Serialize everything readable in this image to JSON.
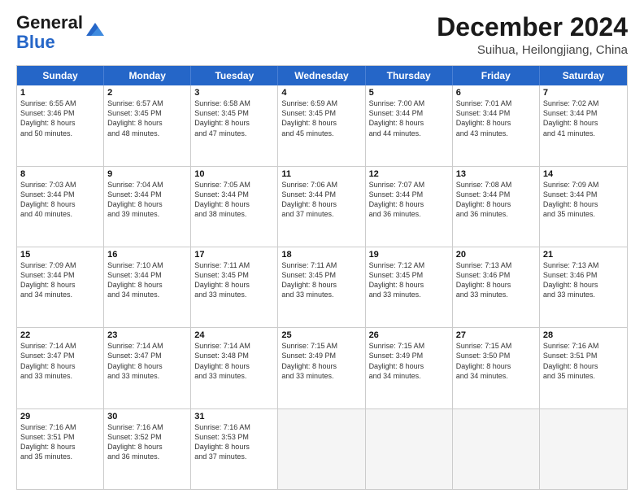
{
  "header": {
    "logo_general": "General",
    "logo_blue": "Blue",
    "month_title": "December 2024",
    "subtitle": "Suihua, Heilongjiang, China"
  },
  "calendar": {
    "days_of_week": [
      "Sunday",
      "Monday",
      "Tuesday",
      "Wednesday",
      "Thursday",
      "Friday",
      "Saturday"
    ],
    "rows": [
      [
        {
          "day": "1",
          "info": "Sunrise: 6:55 AM\nSunset: 3:46 PM\nDaylight: 8 hours\nand 50 minutes."
        },
        {
          "day": "2",
          "info": "Sunrise: 6:57 AM\nSunset: 3:45 PM\nDaylight: 8 hours\nand 48 minutes."
        },
        {
          "day": "3",
          "info": "Sunrise: 6:58 AM\nSunset: 3:45 PM\nDaylight: 8 hours\nand 47 minutes."
        },
        {
          "day": "4",
          "info": "Sunrise: 6:59 AM\nSunset: 3:45 PM\nDaylight: 8 hours\nand 45 minutes."
        },
        {
          "day": "5",
          "info": "Sunrise: 7:00 AM\nSunset: 3:44 PM\nDaylight: 8 hours\nand 44 minutes."
        },
        {
          "day": "6",
          "info": "Sunrise: 7:01 AM\nSunset: 3:44 PM\nDaylight: 8 hours\nand 43 minutes."
        },
        {
          "day": "7",
          "info": "Sunrise: 7:02 AM\nSunset: 3:44 PM\nDaylight: 8 hours\nand 41 minutes."
        }
      ],
      [
        {
          "day": "8",
          "info": "Sunrise: 7:03 AM\nSunset: 3:44 PM\nDaylight: 8 hours\nand 40 minutes."
        },
        {
          "day": "9",
          "info": "Sunrise: 7:04 AM\nSunset: 3:44 PM\nDaylight: 8 hours\nand 39 minutes."
        },
        {
          "day": "10",
          "info": "Sunrise: 7:05 AM\nSunset: 3:44 PM\nDaylight: 8 hours\nand 38 minutes."
        },
        {
          "day": "11",
          "info": "Sunrise: 7:06 AM\nSunset: 3:44 PM\nDaylight: 8 hours\nand 37 minutes."
        },
        {
          "day": "12",
          "info": "Sunrise: 7:07 AM\nSunset: 3:44 PM\nDaylight: 8 hours\nand 36 minutes."
        },
        {
          "day": "13",
          "info": "Sunrise: 7:08 AM\nSunset: 3:44 PM\nDaylight: 8 hours\nand 36 minutes."
        },
        {
          "day": "14",
          "info": "Sunrise: 7:09 AM\nSunset: 3:44 PM\nDaylight: 8 hours\nand 35 minutes."
        }
      ],
      [
        {
          "day": "15",
          "info": "Sunrise: 7:09 AM\nSunset: 3:44 PM\nDaylight: 8 hours\nand 34 minutes."
        },
        {
          "day": "16",
          "info": "Sunrise: 7:10 AM\nSunset: 3:44 PM\nDaylight: 8 hours\nand 34 minutes."
        },
        {
          "day": "17",
          "info": "Sunrise: 7:11 AM\nSunset: 3:45 PM\nDaylight: 8 hours\nand 33 minutes."
        },
        {
          "day": "18",
          "info": "Sunrise: 7:11 AM\nSunset: 3:45 PM\nDaylight: 8 hours\nand 33 minutes."
        },
        {
          "day": "19",
          "info": "Sunrise: 7:12 AM\nSunset: 3:45 PM\nDaylight: 8 hours\nand 33 minutes."
        },
        {
          "day": "20",
          "info": "Sunrise: 7:13 AM\nSunset: 3:46 PM\nDaylight: 8 hours\nand 33 minutes."
        },
        {
          "day": "21",
          "info": "Sunrise: 7:13 AM\nSunset: 3:46 PM\nDaylight: 8 hours\nand 33 minutes."
        }
      ],
      [
        {
          "day": "22",
          "info": "Sunrise: 7:14 AM\nSunset: 3:47 PM\nDaylight: 8 hours\nand 33 minutes."
        },
        {
          "day": "23",
          "info": "Sunrise: 7:14 AM\nSunset: 3:47 PM\nDaylight: 8 hours\nand 33 minutes."
        },
        {
          "day": "24",
          "info": "Sunrise: 7:14 AM\nSunset: 3:48 PM\nDaylight: 8 hours\nand 33 minutes."
        },
        {
          "day": "25",
          "info": "Sunrise: 7:15 AM\nSunset: 3:49 PM\nDaylight: 8 hours\nand 33 minutes."
        },
        {
          "day": "26",
          "info": "Sunrise: 7:15 AM\nSunset: 3:49 PM\nDaylight: 8 hours\nand 34 minutes."
        },
        {
          "day": "27",
          "info": "Sunrise: 7:15 AM\nSunset: 3:50 PM\nDaylight: 8 hours\nand 34 minutes."
        },
        {
          "day": "28",
          "info": "Sunrise: 7:16 AM\nSunset: 3:51 PM\nDaylight: 8 hours\nand 35 minutes."
        }
      ],
      [
        {
          "day": "29",
          "info": "Sunrise: 7:16 AM\nSunset: 3:51 PM\nDaylight: 8 hours\nand 35 minutes."
        },
        {
          "day": "30",
          "info": "Sunrise: 7:16 AM\nSunset: 3:52 PM\nDaylight: 8 hours\nand 36 minutes."
        },
        {
          "day": "31",
          "info": "Sunrise: 7:16 AM\nSunset: 3:53 PM\nDaylight: 8 hours\nand 37 minutes."
        },
        {
          "day": "",
          "info": ""
        },
        {
          "day": "",
          "info": ""
        },
        {
          "day": "",
          "info": ""
        },
        {
          "day": "",
          "info": ""
        }
      ]
    ]
  }
}
